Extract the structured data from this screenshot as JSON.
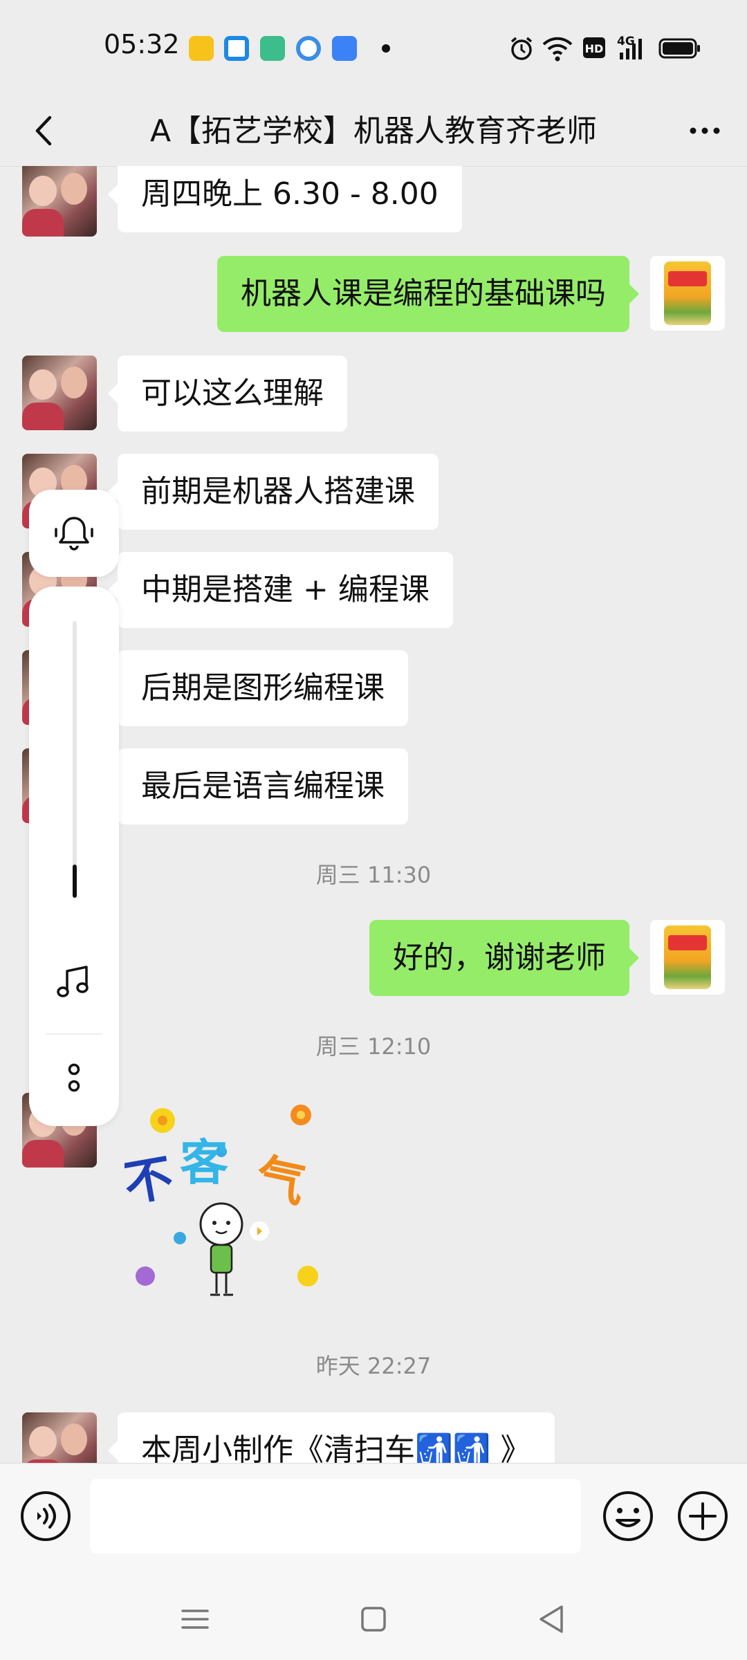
{
  "status_bar": {
    "time": "05:32",
    "network": "4G"
  },
  "header": {
    "title": "A【拓艺学校】机器人教育齐老师"
  },
  "messages": [
    {
      "side": "left",
      "text": "周四晚上 6.30 - 8.00"
    },
    {
      "side": "right",
      "text": "机器人课是编程的基础课吗"
    },
    {
      "side": "left",
      "text": "可以这么理解"
    },
    {
      "side": "left",
      "text": "前期是机器人搭建课"
    },
    {
      "side": "left",
      "text": "中期是搭建 + 编程课"
    },
    {
      "side": "left",
      "text": "后期是图形编程课"
    },
    {
      "side": "left",
      "text": "最后是语言编程课"
    },
    {
      "type": "timestamp",
      "text": "周三 11:30"
    },
    {
      "side": "right",
      "text": "好的，谢谢老师"
    },
    {
      "type": "timestamp",
      "text": "周三 12:10"
    },
    {
      "side": "left",
      "type": "sticker",
      "text": "不客气"
    },
    {
      "type": "timestamp",
      "text": "昨天 22:27"
    },
    {
      "side": "left",
      "text": "本周小制作《清扫车🚮🚮 》"
    }
  ],
  "volume_panel": {
    "level": 0.12
  },
  "colors": {
    "bubble_sent": "#95ec69",
    "bubble_received": "#ffffff",
    "background": "#ededed"
  },
  "input": {
    "value": ""
  }
}
